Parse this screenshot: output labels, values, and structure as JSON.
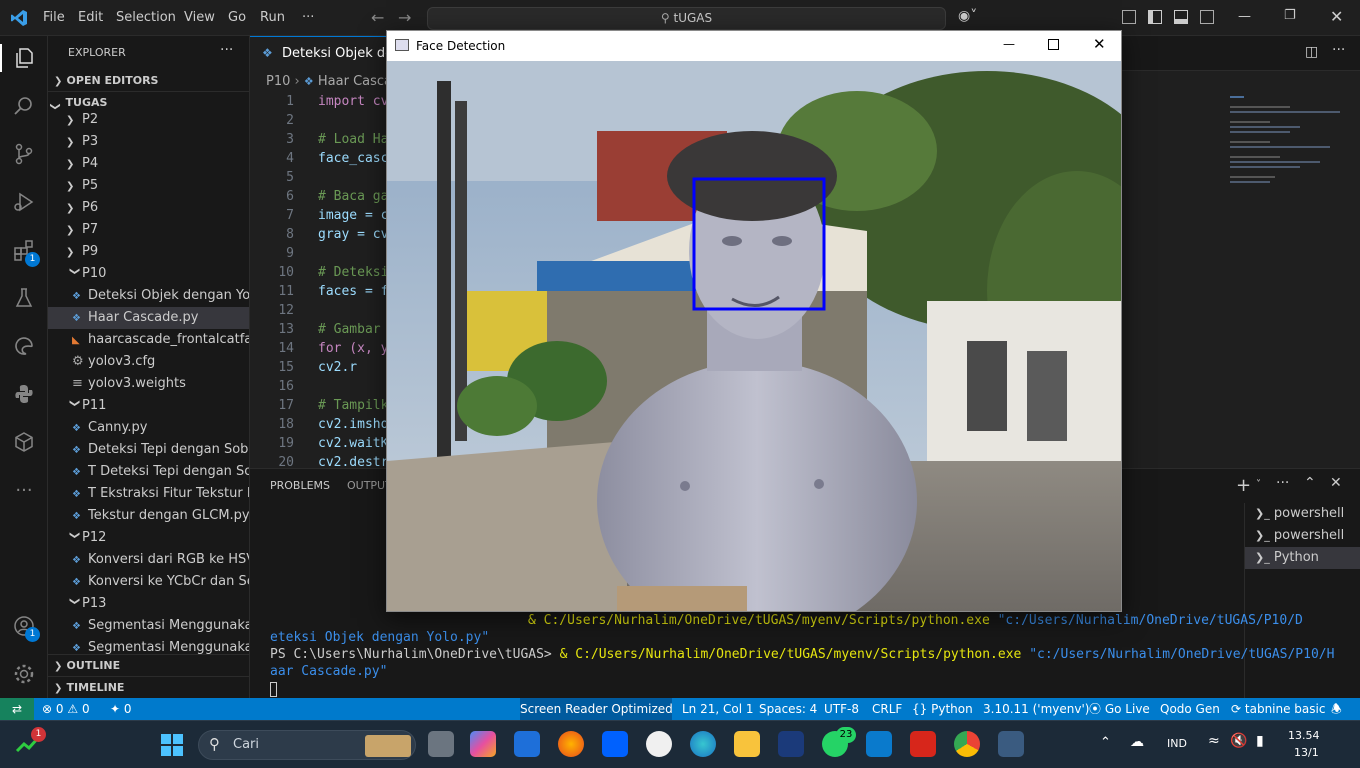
{
  "titlebar": {
    "menu": [
      "File",
      "Edit",
      "Selection",
      "View",
      "Go",
      "Run",
      "···"
    ],
    "search_text": "tUGAS"
  },
  "activity_bar": {
    "extensions_badge": "1",
    "accounts_badge": "1"
  },
  "sidebar": {
    "title": "EXPLORER",
    "more": "···",
    "open_editors": "OPEN EDITORS",
    "root": "TUGAS",
    "items": [
      {
        "label": "P2",
        "kind": "folder"
      },
      {
        "label": "P3",
        "kind": "folder"
      },
      {
        "label": "P4",
        "kind": "folder"
      },
      {
        "label": "P5",
        "kind": "folder"
      },
      {
        "label": "P6",
        "kind": "folder"
      },
      {
        "label": "P7",
        "kind": "folder"
      },
      {
        "label": "P9",
        "kind": "folder"
      },
      {
        "label": "P10",
        "kind": "folder-open"
      },
      {
        "label": "Deteksi Objek dengan Yol...",
        "kind": "py"
      },
      {
        "label": "Haar Cascade.py",
        "kind": "py"
      },
      {
        "label": "haarcascade_frontalcatfac...",
        "kind": "xml"
      },
      {
        "label": "yolov3.cfg",
        "kind": "gear"
      },
      {
        "label": "yolov3.weights",
        "kind": "lines"
      },
      {
        "label": "P11",
        "kind": "folder-open"
      },
      {
        "label": "Canny.py",
        "kind": "py"
      },
      {
        "label": "Deteksi Tepi dengan Sobe...",
        "kind": "py"
      },
      {
        "label": "T Deteksi Tepi dengan So...",
        "kind": "py"
      },
      {
        "label": "T Ekstraksi Fitur Tekstur M...",
        "kind": "py"
      },
      {
        "label": "Tekstur dengan GLCM.py",
        "kind": "py"
      },
      {
        "label": "P12",
        "kind": "folder-open"
      },
      {
        "label": "Konversi dari RGB ke HSV....",
        "kind": "py"
      },
      {
        "label": "Konversi ke YCbCr dan Se...",
        "kind": "py"
      },
      {
        "label": "P13",
        "kind": "folder-open"
      },
      {
        "label": "Segmentasi Menggunaka...",
        "kind": "py"
      },
      {
        "label": "Segmentasi Menggunaka...",
        "kind": "py"
      }
    ],
    "outline": "OUTLINE",
    "timeline": "TIMELINE"
  },
  "editor": {
    "tab_label": "Deteksi Objek den",
    "breadcrumb_folder": "P10",
    "breadcrumb_file": "Haar Casca",
    "lines": [
      {
        "n": "1",
        "text": "import cv"
      },
      {
        "n": "2",
        "text": ""
      },
      {
        "n": "3",
        "text": "# Load Ha"
      },
      {
        "n": "4",
        "text": "face_casc"
      },
      {
        "n": "5",
        "text": ""
      },
      {
        "n": "6",
        "text": "# Baca ga"
      },
      {
        "n": "7",
        "text": "image = c"
      },
      {
        "n": "8",
        "text": "gray = cv"
      },
      {
        "n": "9",
        "text": ""
      },
      {
        "n": "10",
        "text": "# Deteksi"
      },
      {
        "n": "11",
        "text": "faces = f"
      },
      {
        "n": "12",
        "text": ""
      },
      {
        "n": "13",
        "text": "# Gambar"
      },
      {
        "n": "14",
        "text": "for (x, y"
      },
      {
        "n": "15",
        "text": "    cv2.r"
      },
      {
        "n": "16",
        "text": ""
      },
      {
        "n": "17",
        "text": "# Tampilk"
      },
      {
        "n": "18",
        "text": "cv2.imsho"
      },
      {
        "n": "19",
        "text": "cv2.waitK"
      },
      {
        "n": "20",
        "text": "cv2.destr"
      }
    ]
  },
  "panel": {
    "tabs": [
      "PROBLEMS",
      "OUTPUT"
    ],
    "terminals": [
      "powershell",
      "powershell",
      "Python"
    ],
    "term_lines": [
      {
        "prefix": "",
        "cmd": "& C:/Users/Nurhalim/OneDrive/tUGAS/myenv/Scripts/python.exe",
        "arg": "\"c:/Users/Nurhalim/OneDrive/tUGAS/P10/D"
      },
      {
        "prefix": "",
        "cmd": "",
        "arg": "eteksi Objek dengan Yolo.py\""
      },
      {
        "prefix": "PS C:\\Users\\Nurhalim\\OneDrive\\tUGAS> ",
        "cmd": "& C:/Users/Nurhalim/OneDrive/tUGAS/myenv/Scripts/python.exe",
        "arg": "\"c:/Users/Nurhalim/OneDrive/tUGAS/P10/H"
      },
      {
        "prefix": "",
        "cmd": "",
        "arg": "aar Cascade.py\""
      }
    ]
  },
  "statusbar": {
    "errors": "0",
    "warnings": "0",
    "ports": "0",
    "screen_reader": "Screen Reader Optimized",
    "position": "Ln 21, Col 1",
    "spaces": "Spaces: 4",
    "encoding": "UTF-8",
    "eol": "CRLF",
    "language": "Python",
    "interpreter": "3.10.11 ('myenv')",
    "golive": "Go Live",
    "qodo": "Qodo Gen",
    "tabnine": "tabnine basic"
  },
  "face_window": {
    "title": "Face Detection"
  },
  "taskbar": {
    "search_placeholder": "Cari",
    "whatsapp_badge": "23",
    "stock_badge": "1",
    "language": "IND",
    "time": "13.54",
    "date": "13/1"
  },
  "colors": {
    "accent": "#007acc",
    "detection_box": "#0000ff"
  }
}
